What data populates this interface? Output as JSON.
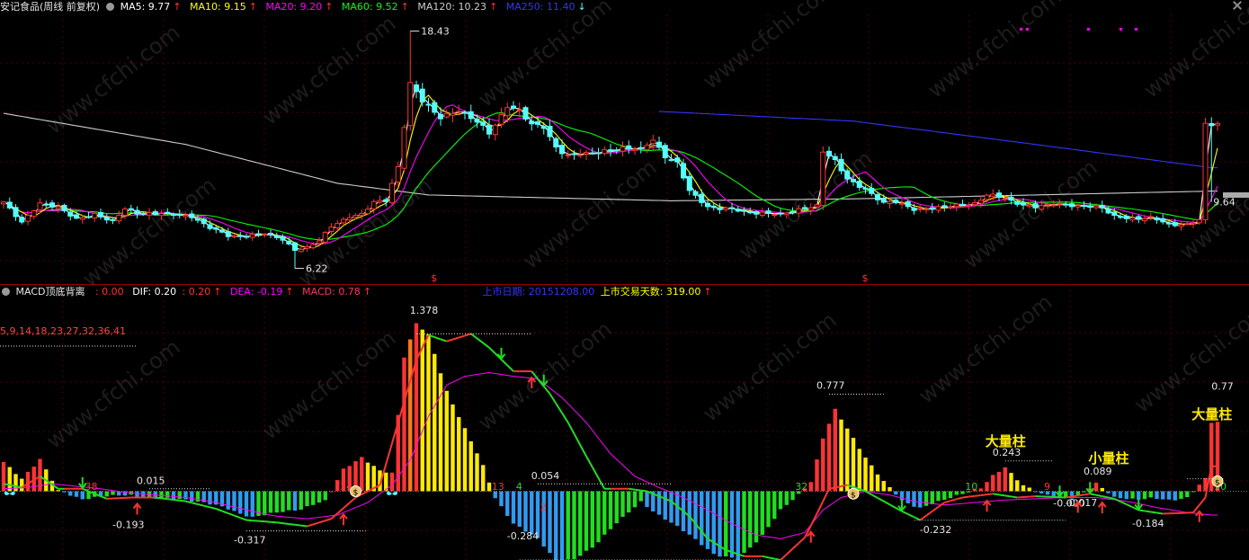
{
  "colors": {
    "ma5": "#ffffff",
    "ma10": "#ffff00",
    "ma20": "#ff00ff",
    "ma60": "#00ff00",
    "ma120": "#cccccc",
    "ma250": "#3333ff",
    "up": "#ff3333",
    "down": "#54ffff",
    "panel_line": "#9a0000",
    "grid": "#4a0000"
  },
  "main_legend": {
    "title": "安记食品(周线 前复权)",
    "ma5": "MA5: 9.77",
    "ma10": "MA10: 9.15",
    "ma20": "MA20: 9.20",
    "ma60": "MA60: 9.52",
    "ma120": "MA120: 10.23",
    "ma250": "MA250: 11.40"
  },
  "sub_legend": {
    "name": "MACD顶底背离",
    "v0": ": 0.00",
    "dif": "DIF: 0.20",
    "v2": ": 0.20",
    "dea": "DEA: -0.19",
    "macd": "MACD: 0.78",
    "listing_date": "上市日期: 20151208.00",
    "trading_days": "上市交易天数: 319.00"
  },
  "icons": {
    "up_arrow": "arrow-up-icon",
    "down_arrow": "arrow-down-icon",
    "settings": "gear-icon",
    "close": "close-icon",
    "money_bag": "money-bag-icon",
    "butterfly": "butterfly-icon"
  },
  "watermark": "www.cfchi.com",
  "chart_data": [
    {
      "type": "candlestick",
      "panel": "price",
      "ylim": [
        5.6,
        19.2
      ],
      "annotations": [
        {
          "label": "18.43",
          "x": 67,
          "value": 18.43
        },
        {
          "label": "6.22",
          "x": 48,
          "value": 6.22
        },
        {
          "label": "9.64",
          "x": 199,
          "value": 9.64
        }
      ],
      "markers": [
        {
          "label": "$",
          "x": 71
        },
        {
          "label": "$",
          "x": 142
        }
      ],
      "keypoints": [
        [
          0,
          9.6
        ],
        [
          3,
          8.6
        ],
        [
          6,
          9.6
        ],
        [
          9,
          9.3
        ],
        [
          12,
          8.8
        ],
        [
          15,
          9.0
        ],
        [
          18,
          8.6
        ],
        [
          20,
          9.3
        ],
        [
          22,
          9.1
        ],
        [
          25,
          9.0
        ],
        [
          28,
          9.0
        ],
        [
          31,
          8.9
        ],
        [
          34,
          8.3
        ],
        [
          37,
          7.9
        ],
        [
          40,
          7.9
        ],
        [
          43,
          8.0
        ],
        [
          46,
          7.7
        ],
        [
          48,
          7.2
        ],
        [
          50,
          7.3
        ],
        [
          52,
          7.6
        ],
        [
          54,
          8.4
        ],
        [
          57,
          8.9
        ],
        [
          59,
          9.0
        ],
        [
          61,
          9.6
        ],
        [
          63,
          9.7
        ],
        [
          65,
          11.5
        ],
        [
          67,
          15.7
        ],
        [
          69,
          14.8
        ],
        [
          72,
          14.0
        ],
        [
          75,
          14.4
        ],
        [
          78,
          13.7
        ],
        [
          80,
          13.2
        ],
        [
          83,
          14.6
        ],
        [
          85,
          14.3
        ],
        [
          87,
          13.6
        ],
        [
          89,
          13.5
        ],
        [
          91,
          12.5
        ],
        [
          93,
          12.0
        ],
        [
          96,
          12.1
        ],
        [
          99,
          12.3
        ],
        [
          102,
          12.4
        ],
        [
          105,
          12.3
        ],
        [
          107,
          12.9
        ],
        [
          109,
          12.0
        ],
        [
          111,
          11.6
        ],
        [
          113,
          10.2
        ],
        [
          116,
          9.4
        ],
        [
          119,
          9.3
        ],
        [
          122,
          9.1
        ],
        [
          125,
          9.1
        ],
        [
          128,
          9.0
        ],
        [
          131,
          9.2
        ],
        [
          134,
          9.5
        ],
        [
          135,
          12.3
        ],
        [
          137,
          11.7
        ],
        [
          139,
          10.8
        ],
        [
          142,
          10.3
        ],
        [
          145,
          9.6
        ],
        [
          147,
          9.6
        ],
        [
          150,
          9.3
        ],
        [
          153,
          9.3
        ],
        [
          156,
          9.4
        ],
        [
          160,
          9.6
        ],
        [
          162,
          10.0
        ],
        [
          165,
          9.8
        ],
        [
          168,
          9.5
        ],
        [
          170,
          9.4
        ],
        [
          173,
          9.5
        ],
        [
          176,
          9.5
        ],
        [
          179,
          9.4
        ],
        [
          181,
          9.3
        ],
        [
          183,
          8.9
        ],
        [
          186,
          8.8
        ],
        [
          189,
          8.8
        ],
        [
          192,
          8.5
        ],
        [
          195,
          8.5
        ],
        [
          197,
          8.7
        ],
        [
          198,
          13.6
        ]
      ]
    },
    {
      "type": "bar+line",
      "panel": "MACD",
      "ylim": [
        -0.55,
        1.5
      ],
      "series_names": [
        "DIF",
        "DEA",
        "MACD"
      ],
      "value_labels": [
        {
          "label": "1.378",
          "x": 69
        },
        {
          "label": "0.777",
          "x": 136
        },
        {
          "label": "0.77",
          "x": 199
        },
        {
          "label": "-0.193",
          "x": 20
        },
        {
          "label": "-0.317",
          "x": 40
        },
        {
          "label": "-0.284",
          "x": 85
        },
        {
          "label": "-0.232",
          "x": 153
        },
        {
          "label": "-0.184",
          "x": 188
        },
        {
          "label": "0.015",
          "x": 24
        },
        {
          "label": "0.054",
          "x": 89
        },
        {
          "label": "0.243",
          "x": 165
        },
        {
          "label": "0.089",
          "x": 180
        },
        {
          "label": "-0.020",
          "x": 175
        },
        {
          "label": "-0.017",
          "x": 177
        }
      ],
      "text_annotations": [
        {
          "label": "大量柱",
          "x": 165
        },
        {
          "label": "小量柱",
          "x": 182
        },
        {
          "label": "大量柱",
          "x": 199
        }
      ],
      "period_text": "5,9,14,18,23,27,32,36,41",
      "count_labels": [
        {
          "label": "34",
          "x": 56
        },
        {
          "label": "38",
          "x": 14
        },
        {
          "label": "13",
          "x": 81
        },
        {
          "label": "4",
          "x": 85
        },
        {
          "label": "2",
          "x": 89
        },
        {
          "label": "32",
          "x": 131
        },
        {
          "label": "10",
          "x": 159
        },
        {
          "label": "9",
          "x": 172
        },
        {
          "label": "10",
          "x": 200
        }
      ],
      "dif_keypoints": [
        [
          0,
          0.06
        ],
        [
          3,
          0.03
        ],
        [
          6,
          0.12
        ],
        [
          9,
          0.02
        ],
        [
          13,
          0.02
        ],
        [
          17,
          -0.06
        ],
        [
          21,
          -0.05
        ],
        [
          25,
          -0.05
        ],
        [
          30,
          -0.08
        ],
        [
          35,
          -0.14
        ],
        [
          40,
          -0.23
        ],
        [
          45,
          -0.25
        ],
        [
          50,
          -0.28
        ],
        [
          54,
          -0.22
        ],
        [
          58,
          -0.05
        ],
        [
          62,
          0.05
        ],
        [
          65,
          0.55
        ],
        [
          68,
          1.05
        ],
        [
          70,
          1.25
        ],
        [
          73,
          1.2
        ],
        [
          77,
          1.26
        ],
        [
          80,
          1.15
        ],
        [
          84,
          0.96
        ],
        [
          87,
          0.96
        ],
        [
          90,
          0.78
        ],
        [
          93,
          0.55
        ],
        [
          96,
          0.28
        ],
        [
          99,
          0.02
        ],
        [
          103,
          0.02
        ],
        [
          106,
          0.0
        ],
        [
          110,
          -0.08
        ],
        [
          113,
          -0.2
        ],
        [
          116,
          -0.38
        ],
        [
          119,
          -0.47
        ],
        [
          122,
          -0.52
        ],
        [
          125,
          -0.52
        ],
        [
          128,
          -0.55
        ],
        [
          132,
          -0.37
        ],
        [
          134,
          -0.18
        ],
        [
          136,
          0.02
        ],
        [
          139,
          0.05
        ],
        [
          142,
          0.0
        ],
        [
          145,
          -0.08
        ],
        [
          148,
          -0.16
        ],
        [
          151,
          -0.23
        ],
        [
          155,
          -0.09
        ],
        [
          158,
          -0.05
        ],
        [
          163,
          -0.02
        ],
        [
          167,
          -0.05
        ],
        [
          170,
          -0.04
        ],
        [
          175,
          -0.05
        ],
        [
          179,
          -0.02
        ],
        [
          183,
          -0.06
        ],
        [
          187,
          -0.15
        ],
        [
          191,
          -0.18
        ],
        [
          196,
          -0.17
        ],
        [
          198,
          -0.05
        ],
        [
          199,
          0.2
        ]
      ],
      "dea_keypoints": [
        [
          0,
          0.02
        ],
        [
          4,
          0.03
        ],
        [
          8,
          0.06
        ],
        [
          12,
          0.04
        ],
        [
          16,
          0.02
        ],
        [
          20,
          -0.01
        ],
        [
          25,
          -0.03
        ],
        [
          30,
          -0.05
        ],
        [
          35,
          -0.09
        ],
        [
          40,
          -0.15
        ],
        [
          45,
          -0.2
        ],
        [
          50,
          -0.22
        ],
        [
          55,
          -0.19
        ],
        [
          60,
          -0.09
        ],
        [
          64,
          0.05
        ],
        [
          67,
          0.25
        ],
        [
          70,
          0.6
        ],
        [
          73,
          0.85
        ],
        [
          76,
          0.92
        ],
        [
          80,
          0.95
        ],
        [
          84,
          0.92
        ],
        [
          88,
          0.9
        ],
        [
          92,
          0.75
        ],
        [
          96,
          0.55
        ],
        [
          100,
          0.3
        ],
        [
          104,
          0.12
        ],
        [
          108,
          0.03
        ],
        [
          112,
          -0.05
        ],
        [
          116,
          -0.15
        ],
        [
          120,
          -0.26
        ],
        [
          124,
          -0.35
        ],
        [
          128,
          -0.38
        ],
        [
          132,
          -0.33
        ],
        [
          135,
          -0.15
        ],
        [
          138,
          -0.05
        ],
        [
          142,
          0.0
        ],
        [
          146,
          -0.03
        ],
        [
          150,
          -0.08
        ],
        [
          155,
          -0.11
        ],
        [
          160,
          -0.09
        ],
        [
          165,
          -0.07
        ],
        [
          170,
          -0.06
        ],
        [
          175,
          -0.05
        ],
        [
          180,
          -0.05
        ],
        [
          185,
          -0.08
        ],
        [
          190,
          -0.13
        ],
        [
          195,
          -0.17
        ],
        [
          199,
          -0.19
        ]
      ],
      "hist_keypoints": [
        [
          0,
          0.23
        ],
        [
          3,
          0.1
        ],
        [
          6,
          0.26
        ],
        [
          9,
          0.0
        ],
        [
          13,
          -0.06
        ],
        [
          17,
          -0.04
        ],
        [
          21,
          -0.03
        ],
        [
          25,
          -0.06
        ],
        [
          29,
          -0.06
        ],
        [
          33,
          -0.09
        ],
        [
          37,
          -0.14
        ],
        [
          41,
          -0.21
        ],
        [
          45,
          -0.17
        ],
        [
          49,
          -0.14
        ],
        [
          53,
          -0.08
        ],
        [
          56,
          0.18
        ],
        [
          59,
          0.27
        ],
        [
          62,
          0.16
        ],
        [
          64,
          0.15
        ],
        [
          66,
          1.08
        ],
        [
          68,
          1.34
        ],
        [
          70,
          1.25
        ],
        [
          73,
          0.8
        ],
        [
          77,
          0.4
        ],
        [
          79,
          0.2
        ],
        [
          81,
          -0.05
        ],
        [
          84,
          -0.26
        ],
        [
          88,
          -0.38
        ],
        [
          91,
          -0.55
        ],
        [
          94,
          -0.55
        ],
        [
          97,
          -0.45
        ],
        [
          101,
          -0.25
        ],
        [
          105,
          -0.09
        ],
        [
          109,
          -0.22
        ],
        [
          113,
          -0.35
        ],
        [
          117,
          -0.5
        ],
        [
          121,
          -0.55
        ],
        [
          125,
          -0.35
        ],
        [
          128,
          -0.15
        ],
        [
          131,
          -0.03
        ],
        [
          133,
          0.08
        ],
        [
          135,
          0.43
        ],
        [
          137,
          0.65
        ],
        [
          139,
          0.5
        ],
        [
          142,
          0.27
        ],
        [
          145,
          0.08
        ],
        [
          148,
          -0.08
        ],
        [
          151,
          -0.13
        ],
        [
          155,
          -0.07
        ],
        [
          158,
          -0.02
        ],
        [
          161,
          0.03
        ],
        [
          163,
          0.12
        ],
        [
          165,
          0.19
        ],
        [
          168,
          0.05
        ],
        [
          171,
          -0.02
        ],
        [
          174,
          -0.06
        ],
        [
          177,
          -0.04
        ],
        [
          180,
          0.06
        ],
        [
          183,
          -0.05
        ],
        [
          186,
          -0.06
        ],
        [
          189,
          -0.06
        ],
        [
          192,
          -0.07
        ],
        [
          195,
          -0.05
        ],
        [
          198,
          0.1
        ],
        [
          199,
          0.55
        ]
      ]
    }
  ]
}
